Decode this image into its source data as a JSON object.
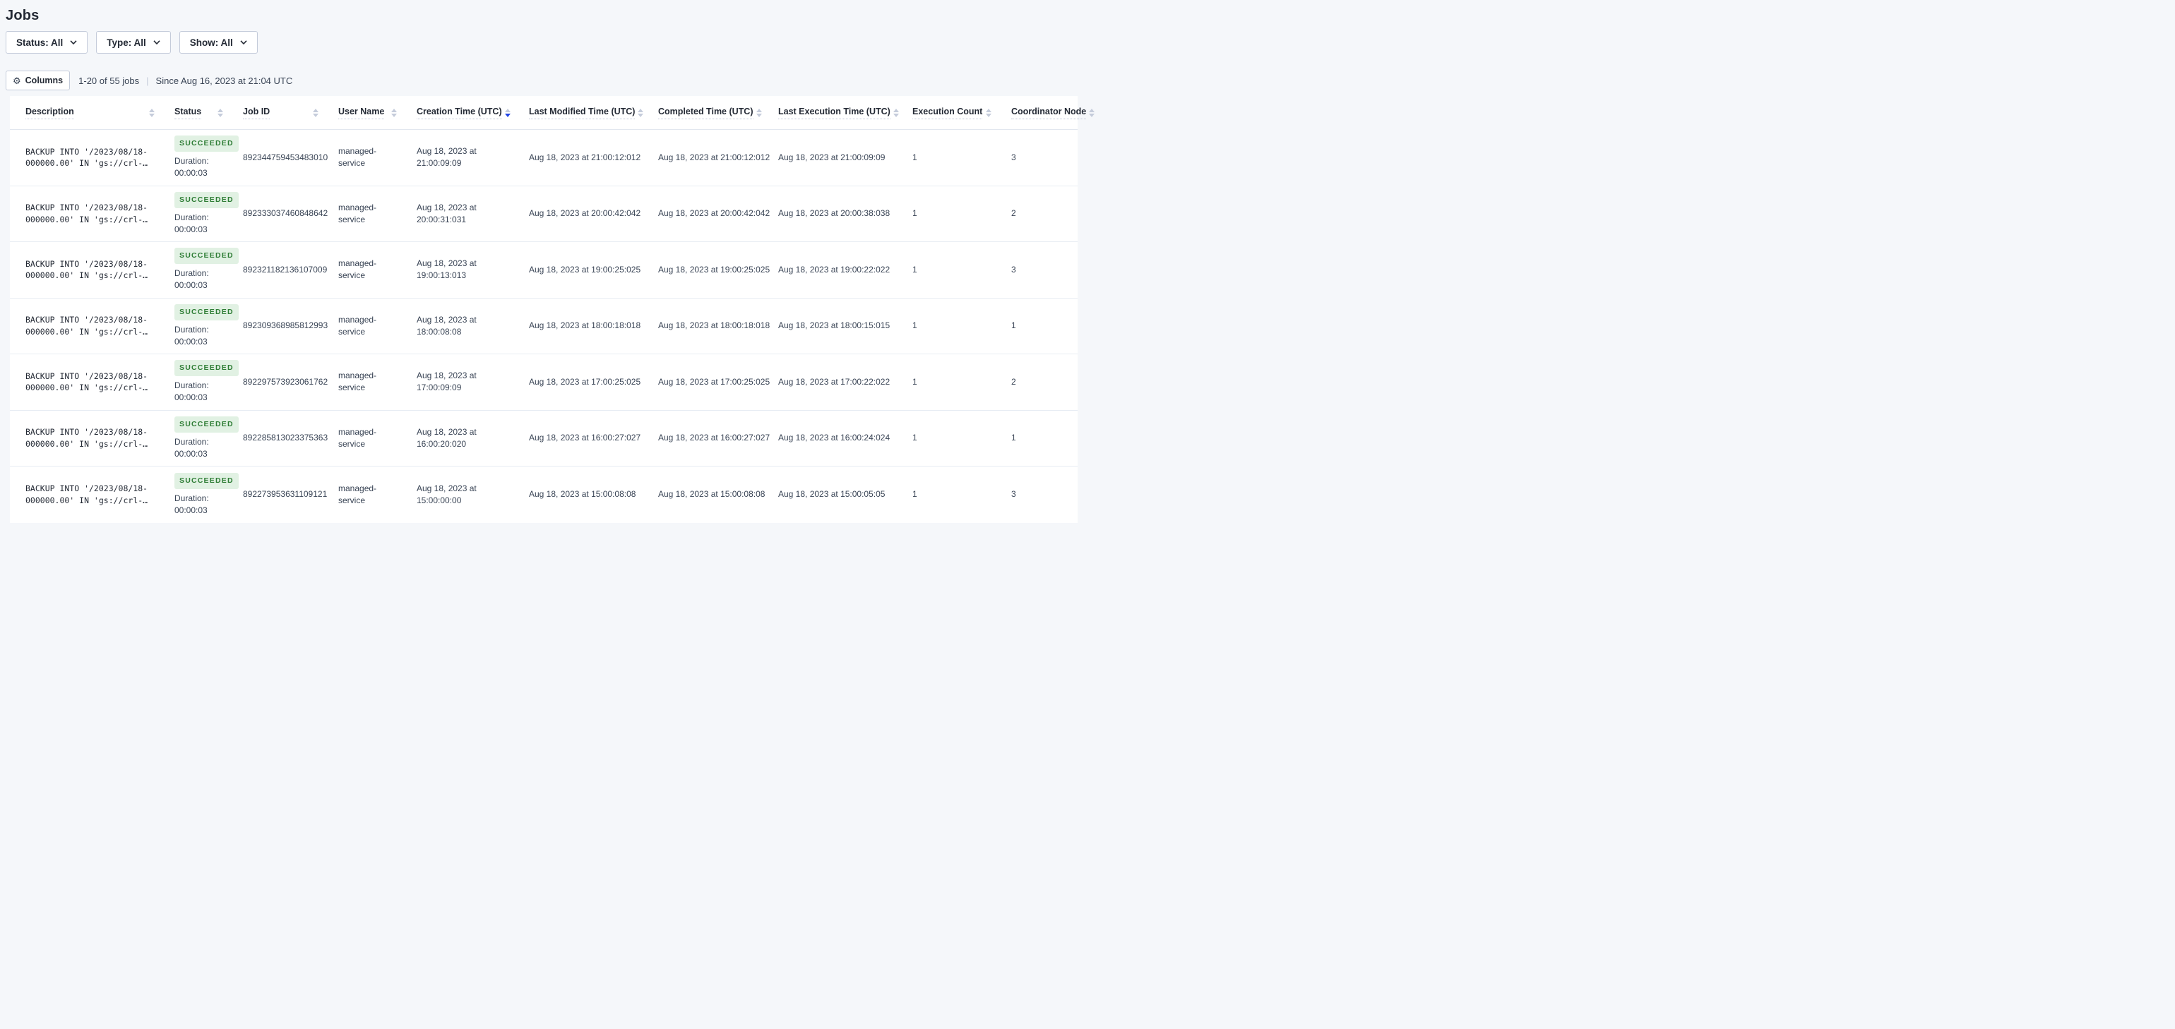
{
  "page": {
    "title": "Jobs"
  },
  "filters": {
    "status": {
      "label": "Status: All"
    },
    "type": {
      "label": "Type: All"
    },
    "show": {
      "label": "Show: All"
    }
  },
  "toolbar": {
    "columns_button": "Columns",
    "results_count": "1-20 of 55 jobs",
    "divider": "|",
    "since": "Since Aug 16, 2023 at 21:04 UTC"
  },
  "table": {
    "columns": [
      {
        "label": "Description",
        "sort": "none"
      },
      {
        "label": "Status",
        "sort": "none"
      },
      {
        "label": "Job ID",
        "sort": "none"
      },
      {
        "label": "User Name",
        "sort": "none"
      },
      {
        "label": "Creation Time (UTC)",
        "sort": "desc"
      },
      {
        "label": "Last Modified Time (UTC)",
        "sort": "none"
      },
      {
        "label": "Completed Time (UTC)",
        "sort": "none"
      },
      {
        "label": "Last Execution Time (UTC)",
        "sort": "none"
      },
      {
        "label": "Execution Count",
        "sort": "none"
      },
      {
        "label": "Coordinator Node",
        "sort": "none"
      }
    ],
    "rows": [
      {
        "description": "BACKUP INTO '/2023/08/18-000000.00' IN 'gs://crl-…",
        "status": "SUCCEEDED",
        "duration": "Duration: 00:00:03",
        "job_id": "892344759453483010",
        "user_name": "managed-service",
        "creation_time": "Aug 18, 2023 at 21:00:09:09",
        "last_modified_time": "Aug 18, 2023 at 21:00:12:012",
        "completed_time": "Aug 18, 2023 at 21:00:12:012",
        "last_execution_time": "Aug 18, 2023 at 21:00:09:09",
        "execution_count": "1",
        "coordinator_node": "3"
      },
      {
        "description": "BACKUP INTO '/2023/08/18-000000.00' IN 'gs://crl-…",
        "status": "SUCCEEDED",
        "duration": "Duration: 00:00:03",
        "job_id": "892333037460848642",
        "user_name": "managed-service",
        "creation_time": "Aug 18, 2023 at 20:00:31:031",
        "last_modified_time": "Aug 18, 2023 at 20:00:42:042",
        "completed_time": "Aug 18, 2023 at 20:00:42:042",
        "last_execution_time": "Aug 18, 2023 at 20:00:38:038",
        "execution_count": "1",
        "coordinator_node": "2"
      },
      {
        "description": "BACKUP INTO '/2023/08/18-000000.00' IN 'gs://crl-…",
        "status": "SUCCEEDED",
        "duration": "Duration: 00:00:03",
        "job_id": "892321182136107009",
        "user_name": "managed-service",
        "creation_time": "Aug 18, 2023 at 19:00:13:013",
        "last_modified_time": "Aug 18, 2023 at 19:00:25:025",
        "completed_time": "Aug 18, 2023 at 19:00:25:025",
        "last_execution_time": "Aug 18, 2023 at 19:00:22:022",
        "execution_count": "1",
        "coordinator_node": "3"
      },
      {
        "description": "BACKUP INTO '/2023/08/18-000000.00' IN 'gs://crl-…",
        "status": "SUCCEEDED",
        "duration": "Duration: 00:00:03",
        "job_id": "892309368985812993",
        "user_name": "managed-service",
        "creation_time": "Aug 18, 2023 at 18:00:08:08",
        "last_modified_time": "Aug 18, 2023 at 18:00:18:018",
        "completed_time": "Aug 18, 2023 at 18:00:18:018",
        "last_execution_time": "Aug 18, 2023 at 18:00:15:015",
        "execution_count": "1",
        "coordinator_node": "1"
      },
      {
        "description": "BACKUP INTO '/2023/08/18-000000.00' IN 'gs://crl-…",
        "status": "SUCCEEDED",
        "duration": "Duration: 00:00:03",
        "job_id": "892297573923061762",
        "user_name": "managed-service",
        "creation_time": "Aug 18, 2023 at 17:00:09:09",
        "last_modified_time": "Aug 18, 2023 at 17:00:25:025",
        "completed_time": "Aug 18, 2023 at 17:00:25:025",
        "last_execution_time": "Aug 18, 2023 at 17:00:22:022",
        "execution_count": "1",
        "coordinator_node": "2"
      },
      {
        "description": "BACKUP INTO '/2023/08/18-000000.00' IN 'gs://crl-…",
        "status": "SUCCEEDED",
        "duration": "Duration: 00:00:03",
        "job_id": "892285813023375363",
        "user_name": "managed-service",
        "creation_time": "Aug 18, 2023 at 16:00:20:020",
        "last_modified_time": "Aug 18, 2023 at 16:00:27:027",
        "completed_time": "Aug 18, 2023 at 16:00:27:027",
        "last_execution_time": "Aug 18, 2023 at 16:00:24:024",
        "execution_count": "1",
        "coordinator_node": "1"
      },
      {
        "description": "BACKUP INTO '/2023/08/18-000000.00' IN 'gs://crl-…",
        "status": "SUCCEEDED",
        "duration": "Duration: 00:00:03",
        "job_id": "892273953631109121",
        "user_name": "managed-service",
        "creation_time": "Aug 18, 2023 at 15:00:00:00",
        "last_modified_time": "Aug 18, 2023 at 15:00:08:08",
        "completed_time": "Aug 18, 2023 at 15:00:08:08",
        "last_execution_time": "Aug 18, 2023 at 15:00:05:05",
        "execution_count": "1",
        "coordinator_node": "3"
      }
    ]
  },
  "icons": {
    "gear": "⚙",
    "chevron_down": "chevron-down",
    "sort": "sort-arrows"
  },
  "colors": {
    "success_badge_bg": "#E1F1E3",
    "success_badge_text": "#2E7D35",
    "active_sort_arrow": "#2145E6",
    "page_background": "#F5F7FA"
  }
}
